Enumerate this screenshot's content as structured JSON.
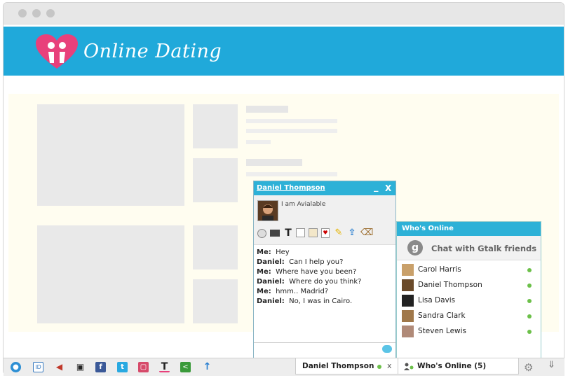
{
  "brand": {
    "name": "Online Dating"
  },
  "chat": {
    "contact_name": "Daniel Thompson",
    "status": "I am Avialable",
    "controls": {
      "minimize": "_",
      "close": "X"
    },
    "messages": [
      {
        "sender": "Me:",
        "text": "Hey"
      },
      {
        "sender": "Daniel:",
        "text": "Can I help you?"
      },
      {
        "sender": "Me:",
        "text": "Where have you been?"
      },
      {
        "sender": "Daniel:",
        "text": "Where do you think?"
      },
      {
        "sender": "Me:",
        "text": "hmm.. Madrid?"
      },
      {
        "sender": "Daniel:",
        "text": "No, I was in Cairo."
      }
    ]
  },
  "who": {
    "title": "Who's Online",
    "gtalk": "Chat with Gtalk friends",
    "friends": [
      {
        "name": "Carol Harris"
      },
      {
        "name": "Daniel Thompson"
      },
      {
        "name": "Lisa Davis"
      },
      {
        "name": "Sandra Clark"
      },
      {
        "name": "Steven Lewis"
      }
    ]
  },
  "bar": {
    "chat_tab_label": "Daniel Thompson",
    "chat_tab_close": "x",
    "who_tab_label": "Who's Online (5)"
  },
  "colors": {
    "accent": "#20a9da",
    "online": "#6cc04a"
  }
}
